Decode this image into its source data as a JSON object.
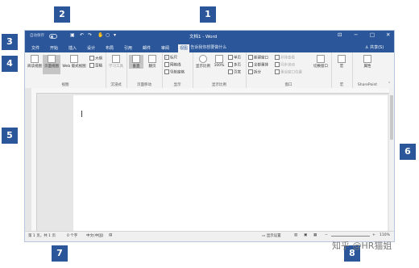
{
  "window": {
    "autosave_label": "自动保存",
    "doc_title": "文档1 - Word",
    "qat_save_icon": "save-icon",
    "qat_undo_icon": "undo-icon",
    "qat_redo_icon": "redo-icon",
    "controls": [
      "⊡",
      "−",
      "□",
      "✕"
    ]
  },
  "tabs": [
    "文件",
    "开始",
    "插入",
    "设计",
    "布局",
    "引用",
    "邮件",
    "审阅",
    "视图"
  ],
  "active_tab_index": 8,
  "tellme": "告诉我你想要做什么",
  "share": "共享(S)",
  "ribbon": {
    "view_group": {
      "label": "视图",
      "read_mode": "阅读视图",
      "print_layout": "页面视图",
      "web_layout": "Web 版式视图",
      "outline": "大纲",
      "draft": "草稿"
    },
    "immersive_group": {
      "label": "沉浸式",
      "learning_tools": "学习工具"
    },
    "page_movement_group": {
      "label": "页面移动",
      "vertical": "垂直",
      "side": "翻页"
    },
    "show_group": {
      "label": "显示",
      "ruler": "标尺",
      "gridlines": "网格线",
      "nav_pane": "导航窗格"
    },
    "zoom_group": {
      "label": "显示比例",
      "zoom": "显示比例",
      "100": "100%",
      "one_page": "单页",
      "multi_page": "多页",
      "page_width": "页宽"
    },
    "window_group": {
      "label": "窗口",
      "new_window": "新建窗口",
      "arrange_all": "全部重排",
      "split": "拆分",
      "side_by_side": "并排查看",
      "sync_scroll": "同步滚动",
      "reset_pos": "重设窗口位置",
      "switch": "切换窗口"
    },
    "macros_group": {
      "label": "宏",
      "macros": "宏"
    },
    "sharepoint_group": {
      "label": "SharePoint",
      "properties": "属性"
    }
  },
  "status": {
    "page": "第 1 页，共 1 页",
    "words": "0 个字",
    "language": "中文(中国)",
    "display_settings": "显示设置",
    "zoom": "110%"
  },
  "badges": [
    "1",
    "2",
    "3",
    "4",
    "5",
    "6",
    "7",
    "8"
  ],
  "watermark": "知乎 @HR猫姐",
  "colors": {
    "accent": "#2b579a"
  }
}
